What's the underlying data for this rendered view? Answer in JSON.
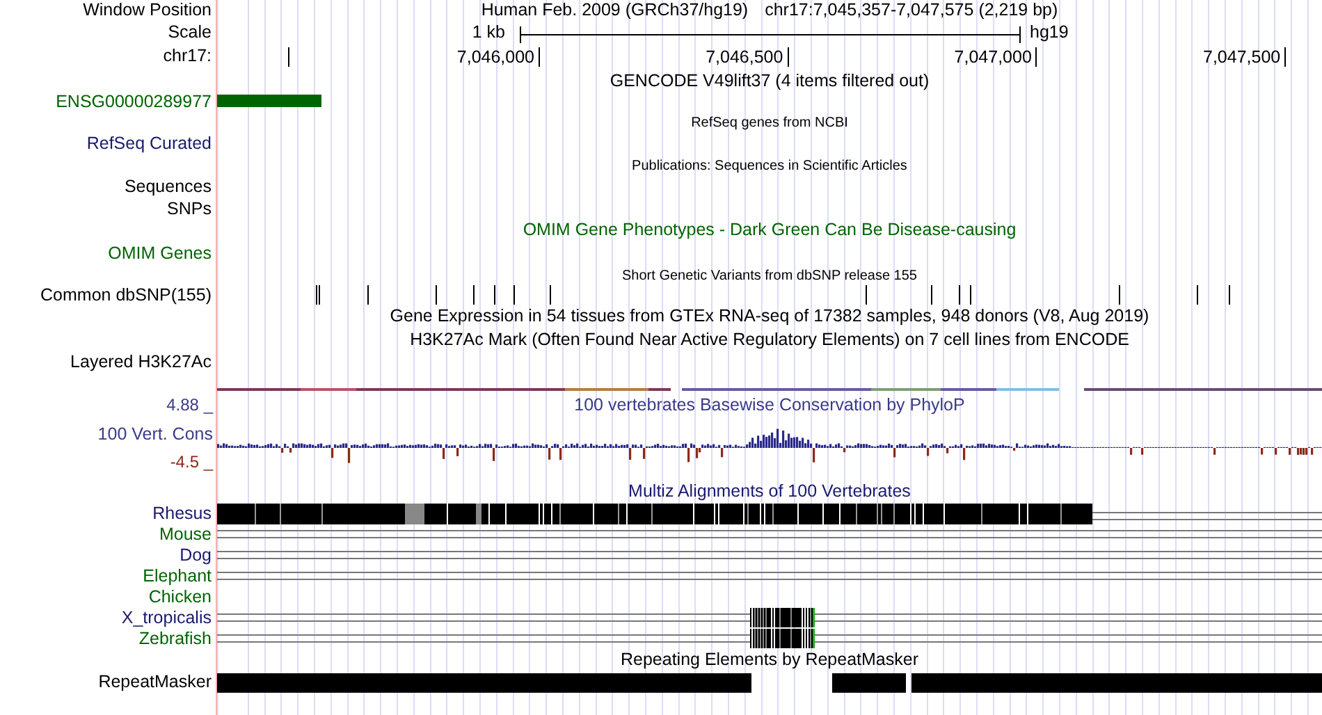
{
  "ruler": {
    "window_position_label": "Window Position",
    "assembly": "Human Feb. 2009 (GRCh37/hg19)",
    "position": "chr17:7,045,357-7,047,575 (2,219 bp)",
    "scale_label": "Scale",
    "scale_size": "1 kb",
    "scale_db": "hg19",
    "chrom_label": "chr17:",
    "ticks": [
      "7,046,000",
      "7,046,500",
      "7,047,000",
      "7,047,500"
    ]
  },
  "gencode": {
    "title": "GENCODE V49lift37 (4 items filtered out)",
    "gene_label": "ENSG00000289977"
  },
  "refseq": {
    "title": "RefSeq genes from NCBI",
    "label": "RefSeq Curated"
  },
  "publications": {
    "title": "Publications: Sequences in Scientific Articles",
    "labels": [
      "Sequences",
      "SNPs"
    ]
  },
  "omim": {
    "title": "OMIM Gene Phenotypes - Dark Green Can Be Disease-causing",
    "label": "OMIM Genes"
  },
  "dbsnp": {
    "title": "Short Genetic Variants from dbSNP release 155",
    "label": "Common dbSNP(155)"
  },
  "gtex": {
    "title": "Gene Expression in 54 tissues from GTEx RNA-seq of 17382 samples, 948 donors (V8, Aug 2019)"
  },
  "h3k27ac": {
    "title": "H3K27Ac Mark (Often Found Near Active Regulatory Elements) on 7 cell lines from ENCODE",
    "label": "Layered H3K27Ac"
  },
  "conservation": {
    "title": "100 vertebrates Basewise Conservation by PhyloP",
    "label": "100 Vert. Cons",
    "max": "4.88 _",
    "min": "-4.5 _"
  },
  "multiz": {
    "title": "Multiz Alignments of 100 Vertebrates",
    "species": [
      {
        "name": "Rhesus",
        "color": "#191970",
        "kind": "dense"
      },
      {
        "name": "Mouse",
        "color": "#006400",
        "kind": "lines"
      },
      {
        "name": "Dog",
        "color": "#191970",
        "kind": "lines"
      },
      {
        "name": "Elephant",
        "color": "#006400",
        "kind": "lines"
      },
      {
        "name": "Chicken",
        "color": "#006400",
        "kind": "empty"
      },
      {
        "name": "X_tropicalis",
        "color": "#191970",
        "kind": "partial"
      },
      {
        "name": "Zebrafish",
        "color": "#006400",
        "kind": "partial"
      }
    ]
  },
  "repeatmasker": {
    "title": "Repeating Elements by RepeatMasker",
    "label": "RepeatMasker"
  }
}
